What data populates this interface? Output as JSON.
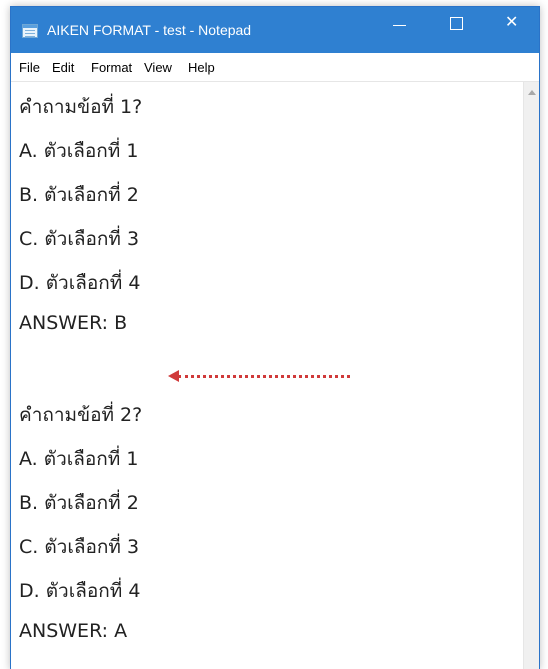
{
  "window": {
    "title": "AIKEN FORMAT - test - Notepad",
    "minimize_symbol": "—",
    "maximize_symbol": "☐",
    "close_symbol": "✕"
  },
  "menu": {
    "items": [
      "File",
      "Edit",
      "Format",
      "View",
      "Help"
    ]
  },
  "editor": {
    "lines": [
      "คำถามข้อที่ 1?",
      "A. ตัวเลือกที่ 1",
      "B. ตัวเลือกที่ 2",
      "C. ตัวเลือกที่ 3",
      "D. ตัวเลือกที่ 4",
      "ANSWER: B",
      "",
      "คำถามข้อที่ 2?",
      "A. ตัวเลือกที่ 1",
      "B. ตัวเลือกที่ 2",
      "C. ตัวเลือกที่ 3",
      "D. ตัวเลือกที่ 4",
      "ANSWER: A"
    ]
  },
  "annotation": {
    "arrow_color": "#d03a3a"
  },
  "colors": {
    "titlebar": "#2f80d1",
    "border": "#2a73c8"
  }
}
